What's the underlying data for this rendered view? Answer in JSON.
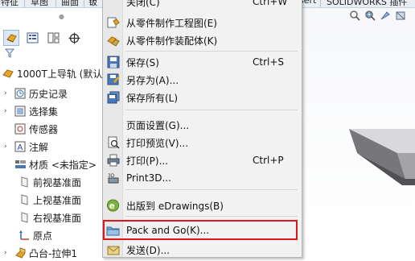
{
  "ribbon": {
    "tabs": [
      "特征",
      "草图",
      "曲面",
      "钣",
      "sert",
      "SOLIDWORKS 插件"
    ]
  },
  "feature_tree": {
    "root_label": "1000T上导轨 (默认",
    "items": [
      {
        "label": "历史记录",
        "icon": "history-icon"
      },
      {
        "label": "选择集",
        "icon": "selection-set-icon"
      },
      {
        "label": "传感器",
        "icon": "sensor-icon"
      },
      {
        "label": "注解",
        "icon": "annotation-icon"
      },
      {
        "label": "材质 <未指定>",
        "icon": "material-icon"
      },
      {
        "label": "前视基准面",
        "icon": "plane-icon"
      },
      {
        "label": "上视基准面",
        "icon": "plane-icon"
      },
      {
        "label": "右视基准面",
        "icon": "plane-icon"
      },
      {
        "label": "原点",
        "icon": "origin-icon"
      },
      {
        "label": "凸台-拉伸1",
        "icon": "extrude-icon"
      }
    ]
  },
  "menu": {
    "top_partial_label": "关闭(C)",
    "top_partial_shortcut": "Ctrl+W",
    "items": [
      {
        "label": "从零件制作工程图(E)",
        "shortcut": "",
        "icon": "drawing-from-part-icon"
      },
      {
        "label": "从零件制作装配体(K)",
        "shortcut": "",
        "icon": "assembly-from-part-icon"
      },
      {
        "label": "保存(S)",
        "shortcut": "Ctrl+S",
        "icon": "save-icon"
      },
      {
        "label": "另存为(A)...",
        "shortcut": "",
        "icon": "save-as-icon"
      },
      {
        "label": "保存所有(L)",
        "shortcut": "",
        "icon": "save-all-icon"
      },
      {
        "label": "页面设置(G)...",
        "shortcut": "",
        "icon": ""
      },
      {
        "label": "打印预览(V)...",
        "shortcut": "",
        "icon": "print-preview-icon"
      },
      {
        "label": "打印(P)...",
        "shortcut": "Ctrl+P",
        "icon": "print-icon"
      },
      {
        "label": "Print3D...",
        "shortcut": "",
        "icon": "print3d-icon"
      },
      {
        "label": "出版到 eDrawings(B)",
        "shortcut": "",
        "icon": "edrawings-icon"
      },
      {
        "label": "Pack and Go(K)...",
        "shortcut": "",
        "icon": "pack-and-go-icon"
      },
      {
        "label": "发送(D)...",
        "shortcut": "",
        "icon": "send-icon"
      }
    ],
    "highlight_color": "#e0161c"
  },
  "colors": {
    "menu_bg": "#f2f2f2",
    "highlight_box": "#e0161c",
    "toolbar_active": "#dde8f6"
  }
}
